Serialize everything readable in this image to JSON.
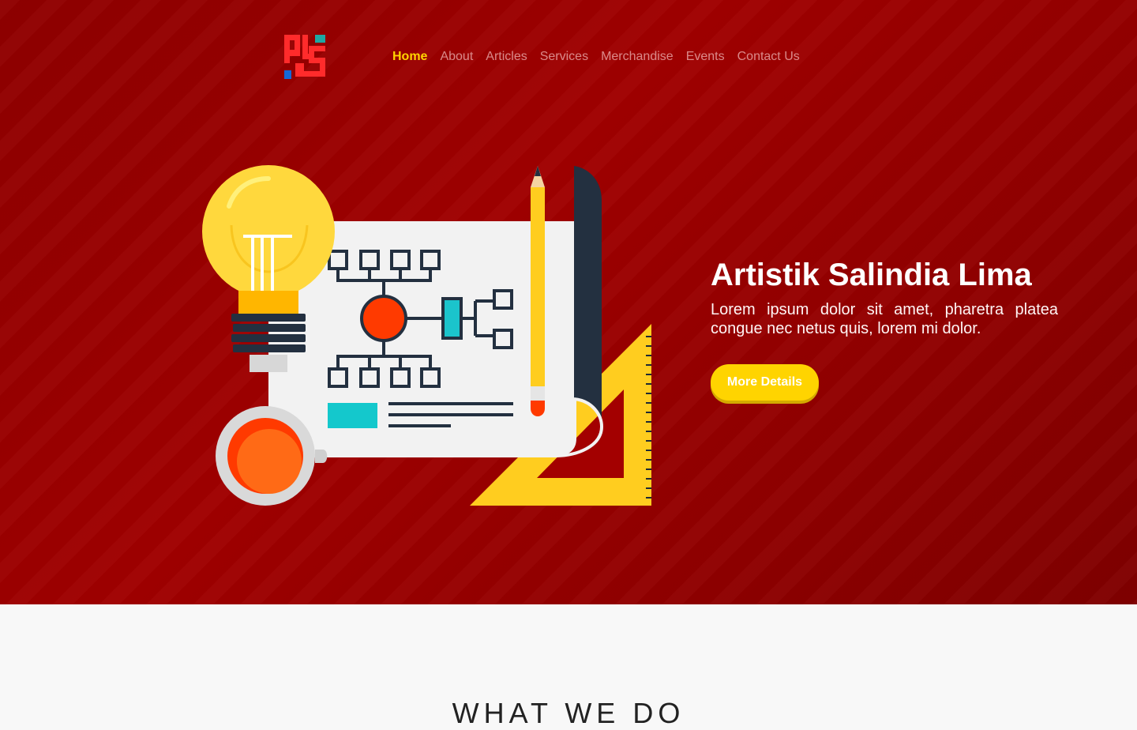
{
  "brand": {
    "logo_alt": "ALS",
    "accent": "#ffd400",
    "hero_background": "#9b0000"
  },
  "nav": {
    "items": [
      {
        "label": "Home",
        "active": true
      },
      {
        "label": "About",
        "active": false
      },
      {
        "label": "Articles",
        "active": false
      },
      {
        "label": "Services",
        "active": false
      },
      {
        "label": "Merchandise",
        "active": false
      },
      {
        "label": "Events",
        "active": false
      },
      {
        "label": "Contact Us",
        "active": false
      }
    ]
  },
  "hero": {
    "title": "Artistik Salindia Lima",
    "description": "Lorem ipsum dolor sit amet, pharetra platea congue nec netus quis, lorem mi dolor.",
    "button_label": "More Details",
    "illustration": "lightbulb-blueprint-pencil-ruler-coffee-illustration"
  },
  "section": {
    "title": "WHAT WE DO"
  }
}
